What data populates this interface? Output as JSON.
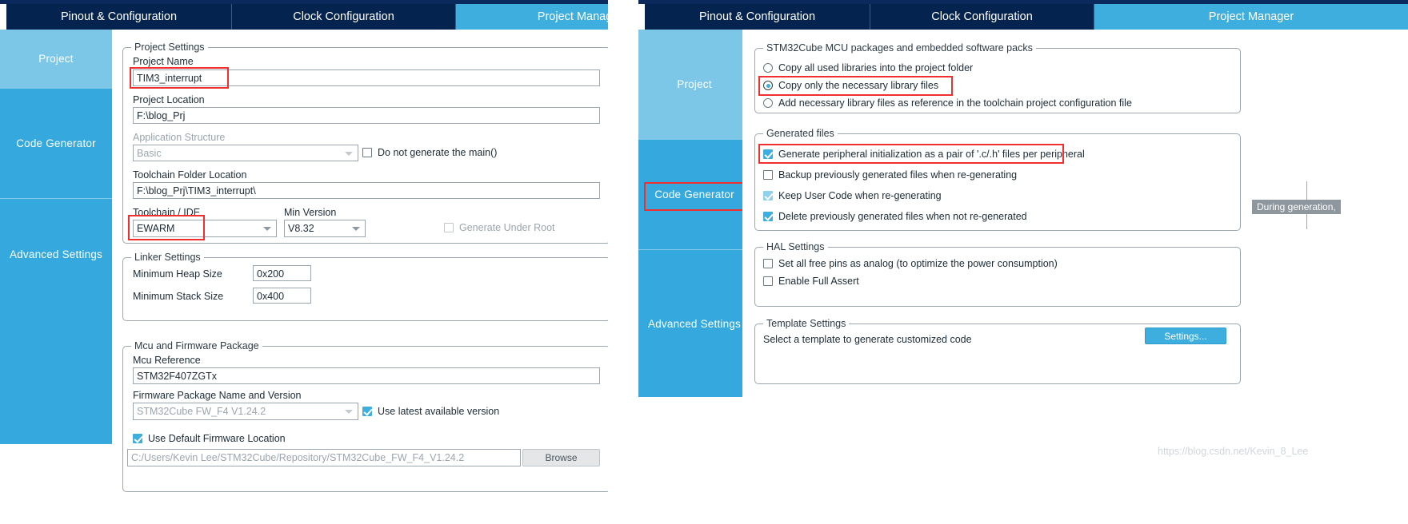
{
  "left_window": {
    "tabs": [
      {
        "label": "Pinout & Configuration",
        "active": false
      },
      {
        "label": "Clock Configuration",
        "active": false
      },
      {
        "label": "Project Manager",
        "active": true
      }
    ],
    "sidebar": [
      {
        "label": "Project",
        "selected": true
      },
      {
        "label": "Code Generator",
        "selected": false
      },
      {
        "label": "Advanced Settings",
        "selected": false
      }
    ],
    "project_settings": {
      "legend": "Project Settings",
      "project_name_label": "Project Name",
      "project_name_value": "TIM3_interrupt",
      "project_location_label": "Project Location",
      "project_location_value": "F:\\blog_Prj",
      "application_structure_label": "Application Structure",
      "application_structure_value": "Basic",
      "do_not_generate_main_label": "Do not generate the main()",
      "do_not_generate_main_checked": false,
      "toolchain_folder_label": "Toolchain Folder Location",
      "toolchain_folder_value": "F:\\blog_Prj\\TIM3_interrupt\\",
      "toolchain_ide_label": "Toolchain / IDE",
      "toolchain_ide_value": "EWARM",
      "min_version_label": "Min Version",
      "min_version_value": "V8.32",
      "generate_under_root_label": "Generate Under Root",
      "generate_under_root_checked": false
    },
    "linker_settings": {
      "legend": "Linker Settings",
      "min_heap_label": "Minimum Heap Size",
      "min_heap_value": "0x200",
      "min_stack_label": "Minimum Stack Size",
      "min_stack_value": "0x400"
    },
    "mcu_firmware": {
      "legend": "Mcu and Firmware Package",
      "mcu_reference_label": "Mcu Reference",
      "mcu_reference_value": "STM32F407ZGTx",
      "firmware_package_label": "Firmware Package Name and Version",
      "firmware_package_value": "STM32Cube FW_F4 V1.24.2",
      "use_latest_label": "Use latest available version",
      "use_latest_checked": true,
      "use_default_location_label": "Use Default Firmware Location",
      "use_default_location_checked": true,
      "firmware_location_value": "C:/Users/Kevin Lee/STM32Cube/Repository/STM32Cube_FW_F4_V1.24.2",
      "browse_label": "Browse"
    }
  },
  "right_window": {
    "tabs": [
      {
        "label": "Pinout & Configuration",
        "active": false
      },
      {
        "label": "Clock Configuration",
        "active": false
      },
      {
        "label": "Project Manager",
        "active": true
      }
    ],
    "sidebar": [
      {
        "label": "Project",
        "selected": false
      },
      {
        "label": "Code Generator",
        "selected": true
      },
      {
        "label": "Advanced Settings",
        "selected": false
      }
    ],
    "mcu_packages": {
      "legend": "STM32Cube MCU packages and embedded software packs",
      "options": [
        {
          "label": "Copy all used libraries into the project folder",
          "selected": false
        },
        {
          "label": "Copy only the necessary library files",
          "selected": true
        },
        {
          "label": "Add necessary library files as reference in the toolchain project configuration file",
          "selected": false
        }
      ]
    },
    "generated_files": {
      "legend": "Generated files",
      "options": [
        {
          "label": "Generate peripheral initialization as a pair of '.c/.h' files per peripheral",
          "checked": true,
          "soft": false
        },
        {
          "label": "Backup previously generated files when re-generating",
          "checked": false,
          "soft": false
        },
        {
          "label": "Keep User Code when re-generating",
          "checked": true,
          "soft": true
        },
        {
          "label": "Delete previously generated files when not re-generated",
          "checked": true,
          "soft": false
        }
      ]
    },
    "hal_settings": {
      "legend": "HAL Settings",
      "options": [
        {
          "label": "Set all free pins as analog (to optimize the power consumption)",
          "checked": false
        },
        {
          "label": "Enable Full Assert",
          "checked": false
        }
      ]
    },
    "template_settings": {
      "legend": "Template Settings",
      "description": "Select a template to generate customized code",
      "settings_button": "Settings..."
    },
    "tooltip": "During generation, ",
    "watermark": "https://blog.csdn.net/Kevin_8_Lee"
  },
  "colors": {
    "tab_inactive_bg": "#04234f",
    "tab_active_bg": "#3eaede",
    "sidebar_bg": "#35a8dd",
    "sidebar_selected_bg": "#7cc7e8",
    "annotation_red": "#f12f2f",
    "accent_blue": "#3eaede"
  }
}
